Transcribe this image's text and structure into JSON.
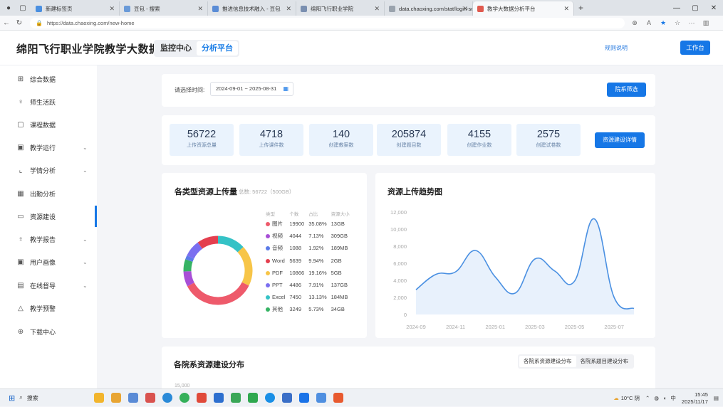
{
  "browser": {
    "tabs": [
      {
        "label": "新建标签页",
        "color": "#4a8fe0"
      },
      {
        "label": "豆包 - 搜索",
        "color": "#6a9ad8"
      },
      {
        "label": "推进信息技术融入 - 豆包",
        "color": "#5a8cd6"
      },
      {
        "label": "绵阳飞行职业学院",
        "color": "#7a8fb0"
      },
      {
        "label": "data.chaoxing.com/stat/login-ser",
        "color": "#9aa3ad"
      },
      {
        "label": "教学大数据分析平台",
        "color": "#e05a4f"
      }
    ],
    "url": "https://data.chaoxing.com/new-home"
  },
  "header": {
    "title": "绵阳飞行职业学院教学大数据",
    "seg_monitor": "监控中心",
    "seg_analysis": "分析平台",
    "rules_link": "规则说明",
    "workbench": "工作台"
  },
  "sidebar": {
    "items": [
      {
        "label": "综合数据",
        "icon": "grid-icon",
        "glyph": "⊞",
        "chev": false
      },
      {
        "label": "师生活跃",
        "icon": "user-icon",
        "glyph": "♀",
        "chev": false
      },
      {
        "label": "课程数据",
        "icon": "book-icon",
        "glyph": "▢",
        "chev": false
      },
      {
        "label": "教学运行",
        "icon": "monitor-icon",
        "glyph": "▣",
        "chev": true
      },
      {
        "label": "学情分析",
        "icon": "line-chart-icon",
        "glyph": "⌞",
        "chev": true
      },
      {
        "label": "出勤分析",
        "icon": "calendar-icon",
        "glyph": "▦",
        "chev": false
      },
      {
        "label": "资源建设",
        "icon": "folder-icon",
        "glyph": "▭",
        "chev": false
      },
      {
        "label": "教学报告",
        "icon": "person-icon",
        "glyph": "♀",
        "chev": true
      },
      {
        "label": "用户画像",
        "icon": "profile-icon",
        "glyph": "▣",
        "chev": true
      },
      {
        "label": "在线督导",
        "icon": "clipboard-icon",
        "glyph": "▤",
        "chev": true
      },
      {
        "label": "教学预警",
        "icon": "alert-icon",
        "glyph": "△",
        "chev": false
      },
      {
        "label": "下载中心",
        "icon": "download-icon",
        "glyph": "⊕",
        "chev": false
      }
    ],
    "active_index": 6
  },
  "filter": {
    "label": "请选择时间:",
    "date_range": "2024-09-01 ~ 2025-08-31",
    "dept_button": "院系筛选"
  },
  "stats": [
    {
      "value": "56722",
      "label": "上传资源总量"
    },
    {
      "value": "4718",
      "label": "上传课件数"
    },
    {
      "value": "140",
      "label": "创建教案数"
    },
    {
      "value": "205874",
      "label": "创建题目数"
    },
    {
      "value": "4155",
      "label": "创建作业数"
    },
    {
      "value": "2575",
      "label": "创建试卷数"
    }
  ],
  "stats_button": "资源建设详情",
  "resource_card": {
    "title": "各类型资源上传量",
    "total": "总数: 56722（500GB）",
    "headers": [
      "类型",
      "个数",
      "占比",
      "资源大小"
    ]
  },
  "trend_card": {
    "title": "资源上传趋势图"
  },
  "bottom_card": {
    "title": "各院系资源建设分布",
    "tab1": "各院系资源建设分布",
    "tab2": "各院系题目建设分布",
    "first_tick": "15,000"
  },
  "chart_data": [
    {
      "type": "pie",
      "categories": [
        "图片",
        "视频",
        "音频",
        "Word",
        "PDF",
        "PPT",
        "Excel",
        "其他"
      ],
      "values": [
        19900,
        4044,
        1088,
        5639,
        10866,
        4486,
        7450,
        3249
      ],
      "percent": [
        "35.08%",
        "7.13%",
        "1.92%",
        "9.94%",
        "19.16%",
        "7.91%",
        "13.13%",
        "5.73%"
      ],
      "size": [
        "13GB",
        "309GB",
        "189MB",
        "2GB",
        "5GB",
        "137GB",
        "184MB",
        "34GB"
      ],
      "colors": [
        "#ee5a6b",
        "#a84fd6",
        "#5b7be8",
        "#e43f4f",
        "#f7c548",
        "#7b6ff0",
        "#35c2c6",
        "#36b364"
      ],
      "title": "各类型资源上传量"
    },
    {
      "type": "area",
      "title": "资源上传趋势图",
      "x": [
        "2024-09",
        "2024-10",
        "2024-11",
        "2024-12",
        "2025-01",
        "2025-02",
        "2025-03",
        "2025-04",
        "2025-05",
        "2025-06",
        "2025-07",
        "2025-08"
      ],
      "x_ticks": [
        "2024-09",
        "2024-11",
        "2025-01",
        "2025-03",
        "2025-05",
        "2025-07"
      ],
      "values": [
        2900,
        4700,
        5000,
        7500,
        4400,
        2500,
        6500,
        5100,
        3900,
        11200,
        2000,
        700
      ],
      "ylim": [
        0,
        12000
      ],
      "y_ticks": [
        "12,000",
        "10,000",
        "8,000",
        "6,000",
        "4,000",
        "2,000",
        "0"
      ],
      "color": "#4a90e2"
    }
  ],
  "taskbar": {
    "search": "搜索",
    "weather": "10°C 阴",
    "time": "15:45",
    "date": "2025/11/17"
  }
}
